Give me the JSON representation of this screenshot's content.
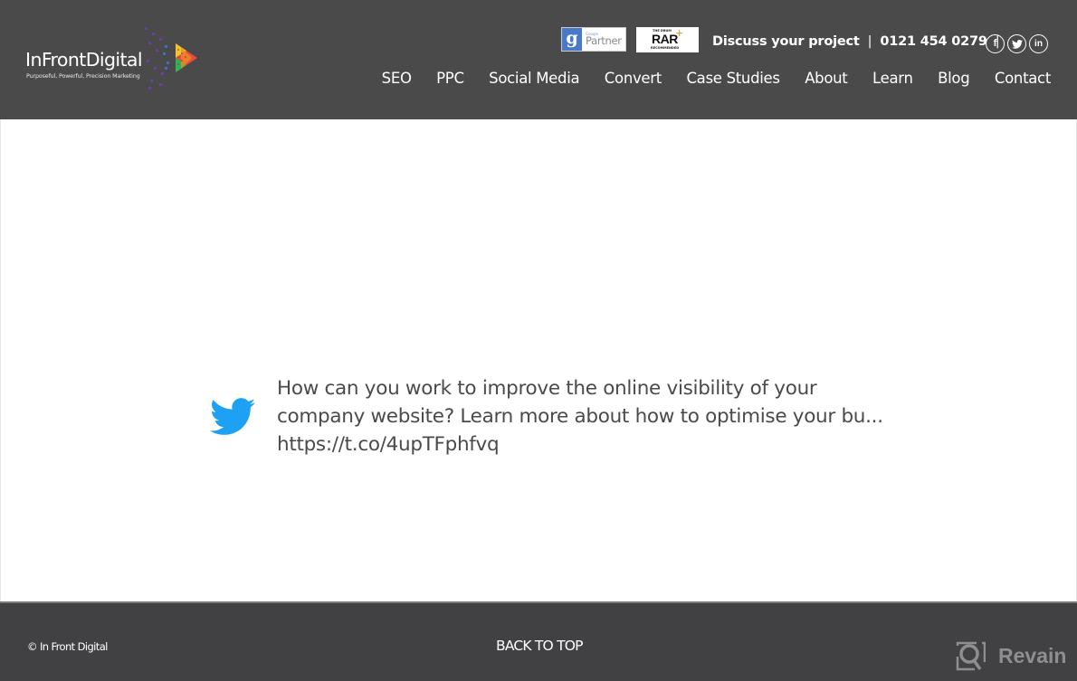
{
  "header": {
    "logo": {
      "name": "InFrontDigital",
      "tagline": "Purposeful, Powerful, Precision Marketing"
    },
    "badges": {
      "google_partner": {
        "letter": "g",
        "small": "Google",
        "label": "Partner"
      },
      "rar": {
        "top": "THE DRUM",
        "label": "RAR",
        "plus": "+",
        "bottom": "RECOMMENDED"
      }
    },
    "contact": {
      "cta": "Discuss your project",
      "separator": "|",
      "phone": "0121 454 0279"
    },
    "social": [
      {
        "icon": "facebook-icon",
        "glyph": "f"
      },
      {
        "icon": "twitter-icon",
        "glyph": "t"
      },
      {
        "icon": "linkedin-icon",
        "glyph": "in"
      }
    ],
    "nav": [
      {
        "label": "SEO"
      },
      {
        "label": "PPC"
      },
      {
        "label": "Social Media"
      },
      {
        "label": "Convert"
      },
      {
        "label": "Case Studies"
      },
      {
        "label": "About"
      },
      {
        "label": "Learn"
      },
      {
        "label": "Blog"
      },
      {
        "label": "Contact"
      }
    ]
  },
  "tweet": {
    "icon": "twitter-bird-icon",
    "lines": [
      "How can you work to improve the online visibility of your",
      "company website? Learn more about how to optimise your bu...",
      "https://t.co/4upTFphfvq"
    ]
  },
  "footer": {
    "copyright": "© In Front Digital",
    "back_to_top": "BACK TO TOP",
    "watermark": "Revain"
  },
  "colors": {
    "header_bg": "#4a4a4b",
    "footer_bg": "#414143",
    "twitter_blue": "#1da1f2",
    "tweet_text": "#4a4a4a"
  }
}
